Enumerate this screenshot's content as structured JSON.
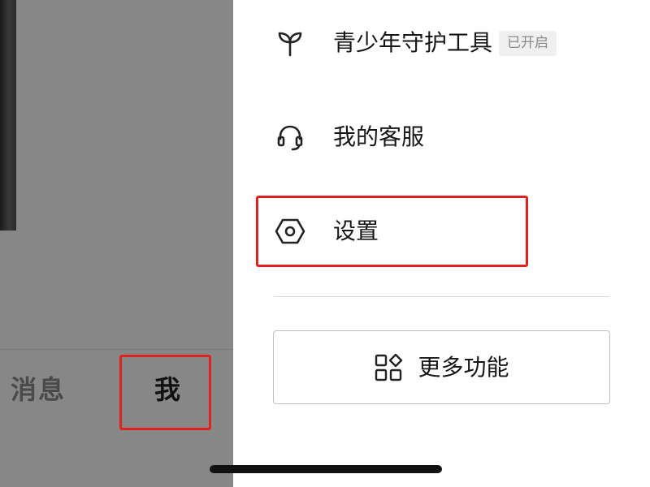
{
  "tabbar": {
    "messages_label": "消息",
    "me_label": "我"
  },
  "menu": {
    "items": [
      {
        "label": "青少年守护工具",
        "icon": "sprout-icon",
        "badge": "已开启"
      },
      {
        "label": "我的客服",
        "icon": "headset-icon"
      },
      {
        "label": "设置",
        "icon": "settings-hexagon-icon"
      }
    ],
    "more_button": {
      "label": "更多功能",
      "icon": "apps-grid-icon"
    }
  },
  "colors": {
    "highlight": "#e0221e",
    "overlay": "#878787",
    "text": "#161616",
    "badge_bg": "#f0f0f0",
    "badge_text": "#8a8a8a"
  }
}
